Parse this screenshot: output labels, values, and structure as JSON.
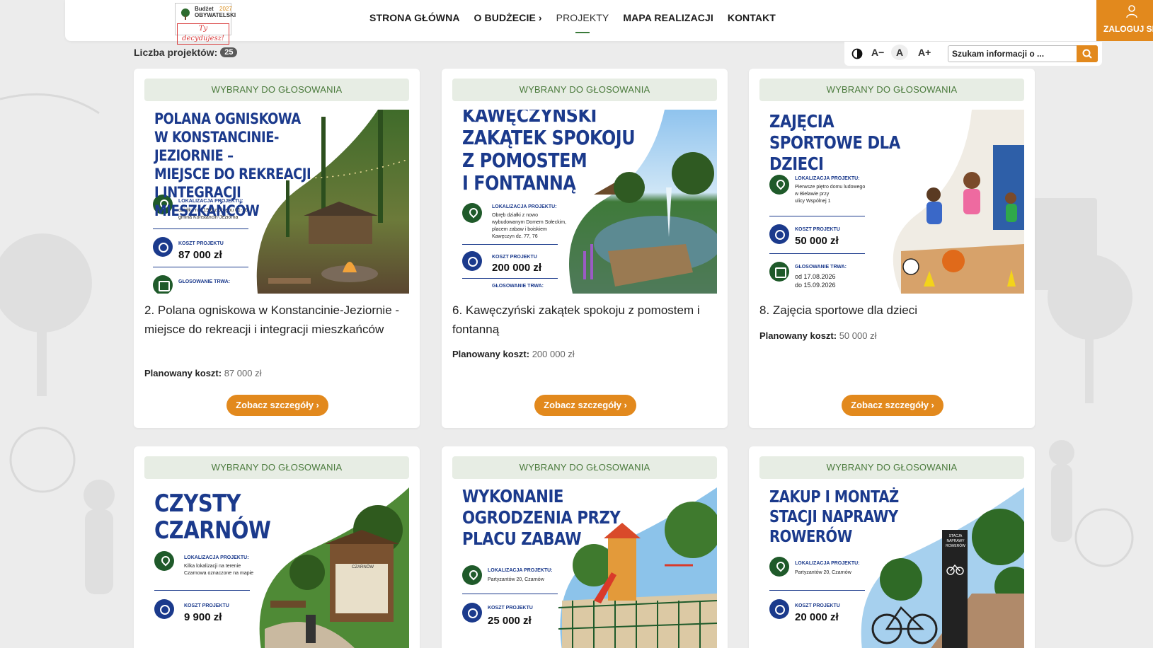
{
  "logo": {
    "line1": "Budżet",
    "line2": "OBYWATELSKI",
    "year": "2027",
    "tagline": "Ty decydujesz!"
  },
  "nav": {
    "items": [
      {
        "label": "STRONA GŁÓWNA"
      },
      {
        "label": "O BUDŻECIE ›"
      },
      {
        "label": "PROJEKTY"
      },
      {
        "label": "MAPA REALIZACJI"
      },
      {
        "label": "KONTAKT"
      }
    ],
    "login_label": "ZALOGUJ SIĘ"
  },
  "count": {
    "label": "Liczba projektów:",
    "value": "25"
  },
  "tools": {
    "font_decrease": "A−",
    "font_normal": "A",
    "font_increase": "A+",
    "search_placeholder": "Szukam informacji o ..."
  },
  "colors": {
    "accent": "#e2891d",
    "status_bg": "#e7ede4",
    "status_text": "#4a7a3c",
    "poster_blue": "#1b3a8c"
  },
  "cards": [
    {
      "status": "WYBRANY DO GŁOSOWANIA",
      "poster_title": "POLANA OGNISKOWA\nW KONSTANCINIE-JEZIORNIE –\nMIEJSCE DO REKREACJI\nI INTEGRACJI MIESZKAŃCÓW",
      "loc_label": "LOKALIZACJA PROJEKTU:",
      "loc_value": "działka nr 119/6 z obrębu 01-26\ngmina Konstancin-Jeziorna",
      "cost_label": "KOSZT PROJEKTU",
      "cost_value": "87 000 zł",
      "vote_label": "GŁOSOWANIE TRWA:",
      "title_num": "2.",
      "title": "Polana ogniskowa w Konstancinie-Jeziornie - miejsce do rekreacji i integracji mieszkańców",
      "planned_label": "Planowany koszt:",
      "planned_value": "87 000 zł",
      "button": "Zobacz szczegóły ›"
    },
    {
      "status": "WYBRANY DO GŁOSOWANIA",
      "poster_title": "KAWĘCZYŃSKI\nZAKĄTEK SPOKOJU\nZ POMOSTEM\nI FONTANNĄ",
      "loc_label": "LOKALIZACJA PROJEKTU:",
      "loc_value": "Obręb działki z nowo\nwybudowanym Domem Sołeckim,\nplacem zabaw i boiskiem\nKawęczyn dz. 77, 76",
      "cost_label": "KOSZT PROJEKTU",
      "cost_value": "200 000 zł",
      "vote_label": "GŁOSOWANIE TRWA:",
      "title_num": "6.",
      "title": "Kawęczyński zakątek spokoju z pomostem i fontanną",
      "planned_label": "Planowany koszt:",
      "planned_value": "200 000 zł",
      "button": "Zobacz szczegóły ›"
    },
    {
      "status": "WYBRANY DO GŁOSOWANIA",
      "poster_title": "ZAJĘCIA\nSPORTOWE DLA DZIECI",
      "loc_label": "LOKALIZACJA PROJEKTU:",
      "loc_value": "Pierwsze piętro domu ludowego\nw Bielawie przy\nulicy Wspólnej 1",
      "cost_label": "KOSZT PROJEKTU",
      "cost_value": "50 000 zł",
      "vote_label": "GŁOSOWANIE TRWA:",
      "vote_value": "od 17.08.2026\ndo 15.09.2026",
      "title_num": "8.",
      "title": "Zajęcia sportowe dla dzieci",
      "planned_label": "Planowany koszt:",
      "planned_value": "50 000 zł",
      "button": "Zobacz szczegóły ›"
    },
    {
      "status": "WYBRANY DO GŁOSOWANIA",
      "poster_title": "CZYSTY CZARNÓW",
      "loc_label": "LOKALIZACJA PROJEKTU:",
      "loc_value": "Kilka lokalizacji na terenie\nCzarnowa oznaczone na mapie",
      "cost_label": "KOSZT PROJEKTU",
      "cost_value": "9 900 zł",
      "sign_text": "CZARNÓW"
    },
    {
      "status": "WYBRANY DO GŁOSOWANIA",
      "poster_title": "WYKONANIE\nOGRODZENIA PRZY\nPLACU ZABAW",
      "loc_label": "LOKALIZACJA PROJEKTU:",
      "loc_value": "Partyzantów 20, Czarnów",
      "cost_label": "KOSZT PROJEKTU",
      "cost_value": "25 000 zł"
    },
    {
      "status": "WYBRANY DO GŁOSOWANIA",
      "poster_title": "ZAKUP I MONTAŻ\nSTACJI NAPRAWY ROWERÓW",
      "loc_label": "LOKALIZACJA PROJEKTU:",
      "loc_value": "Partyzantów 20, Czarnów",
      "cost_label": "KOSZT PROJEKTU",
      "cost_value": "20 000 zł",
      "station_text": "STACJA\nNAPRAWY\nROWERÓW"
    }
  ]
}
